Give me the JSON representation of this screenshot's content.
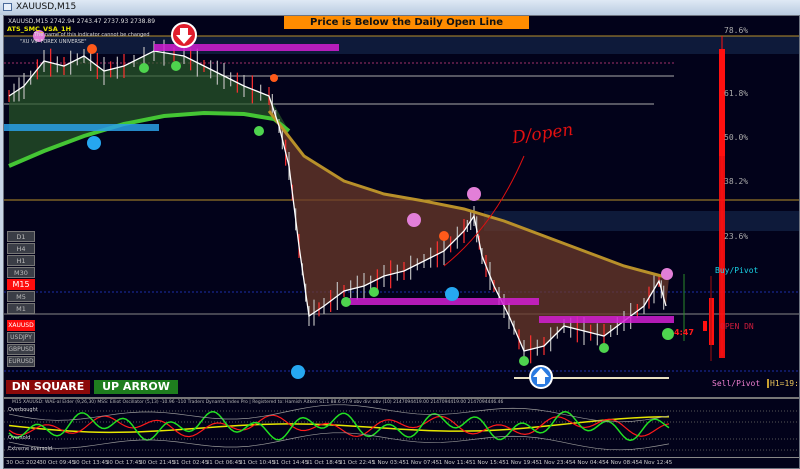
{
  "window": {
    "title": "XAUUSD,M15"
  },
  "chart": {
    "header": "XAUUSD,M15  2742.94 2743.47 2737.93 2738.89",
    "indicator_name": "ATS_SMC_VSA_1H",
    "indicator_note": "The name of this indicator cannot be changed",
    "indicator_brand": "\"XU VIP FOREX UNIVERSE\"",
    "banner": "Price is Below the Daily Open Line",
    "annotation": "D/open",
    "fib_levels": [
      "78.6%",
      "61.8%",
      "50.0%",
      "38.2%",
      "23.6%"
    ],
    "buy_pivot": "Buy/Pivot",
    "open_dn": "OPEN DN",
    "sell_pivot": "Sell/Pivot",
    "h1_timer": "H1=19:4",
    "timer": "4:47",
    "colors": {
      "background": "#02021a",
      "banner": "#ff8c00",
      "ema": "#44c634",
      "ma": "#b8902a",
      "candle_down": "#ff1010"
    }
  },
  "timeframes": [
    {
      "label": "D1"
    },
    {
      "label": "H4"
    },
    {
      "label": "H1"
    },
    {
      "label": "M30"
    },
    {
      "label": "M15",
      "active": true
    },
    {
      "label": "M5"
    },
    {
      "label": "M1"
    }
  ],
  "symbols": [
    {
      "label": "XAUUSD",
      "active": true
    },
    {
      "label": "USDJPY"
    },
    {
      "label": "GBPUSD"
    },
    {
      "label": "EURUSD"
    }
  ],
  "buttons": {
    "dn_square": "DN SQUARE",
    "up_arrow": "UP ARROW"
  },
  "subwindow": {
    "header": "M15 XAUUSD: WAE-al Elder (9,26,30)  MSS: Elliot Oscillator (5,13) -10.96 -110  Traders Dynamic Index Pro | Registered to: Hamish Aitken S1:1 88.6 57.9  obv div: obv (10) 2147094419.00 2147094419.00 2147094446.46",
    "overbought": "Overbought",
    "oversold": "Oversold",
    "extreme_oversold": "Extreme oversold"
  },
  "time_axis": [
    "30 Oct 2024",
    "30 Oct 09:45",
    "30 Oct 13:45",
    "30 Oct 17:45",
    "30 Oct 21:45",
    "31 Oct 02:45",
    "31 Oct 06:45",
    "31 Oct 10:45",
    "31 Oct 14:45",
    "31 Oct 18:45",
    "31 Oct 22:45",
    "1 Nov 03:45",
    "1 Nov 07:45",
    "1 Nov 11:45",
    "1 Nov 15:45",
    "1 Nov 19:45",
    "1 Nov 23:45",
    "4 Nov 04:45",
    "4 Nov 08:45",
    "4 Nov 12:45"
  ]
}
